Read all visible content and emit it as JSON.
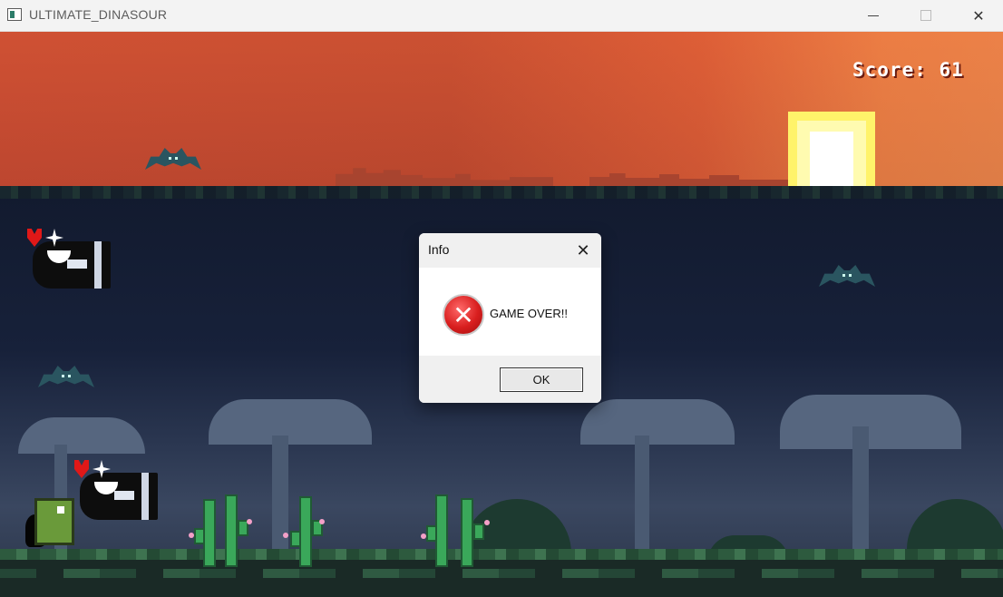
{
  "window": {
    "title": "ULTIMATE_DINASOUR",
    "app_icon": "app-window-icon",
    "controls": {
      "minimize": "minimize-icon",
      "maximize": "maximize-icon",
      "close": "✕"
    }
  },
  "hud": {
    "score_text": "Score: 61"
  },
  "dialog": {
    "title": "Info",
    "close_glyph": "✕",
    "icon": "error-icon",
    "icon_glyph": "✕",
    "message": "GAME OVER!!",
    "ok_label": "OK"
  },
  "colors": {
    "sky": "#c74a32",
    "sun": "#fff36a",
    "dialog_bg": "#ffffff",
    "error_red": "#d81e1e"
  }
}
